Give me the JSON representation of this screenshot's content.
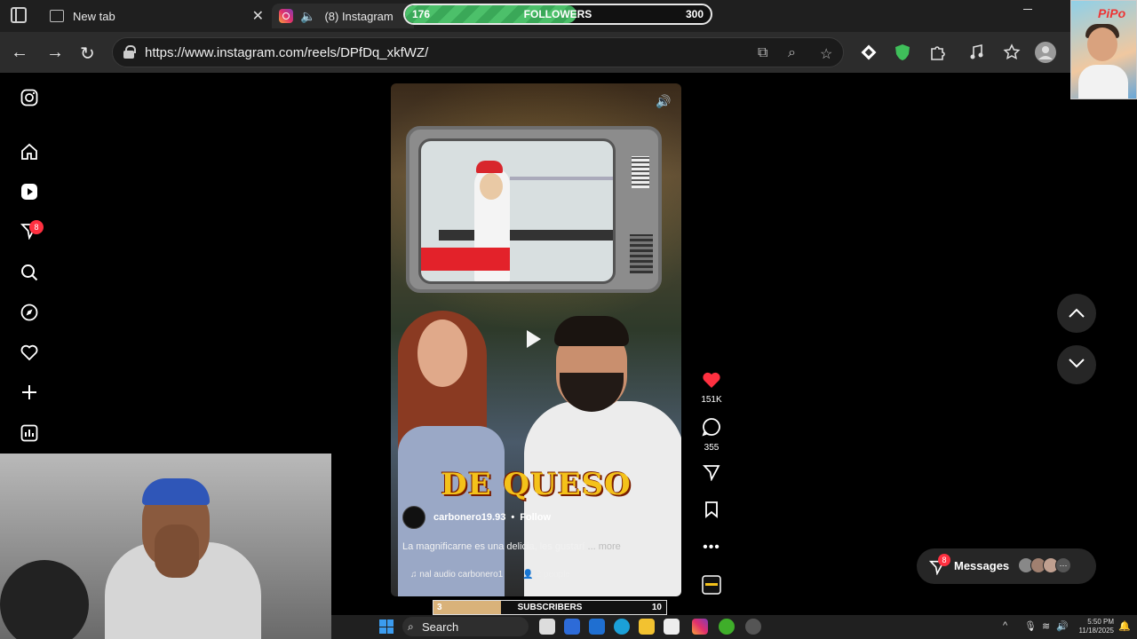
{
  "browser": {
    "tabs": [
      {
        "label": "New tab"
      },
      {
        "label": "(8) Instagram"
      }
    ],
    "url": "https://www.instagram.com/reels/DPfDq_xkfWZ/"
  },
  "overlay": {
    "followers": {
      "start": "176",
      "label": "FOLLOWERS",
      "end": "300",
      "progress": 0.56
    },
    "subscribers": {
      "start": "3",
      "label": "SUBSCRIBERS",
      "end": "10",
      "progress": 0.29
    },
    "avatar_tag": "PiPo"
  },
  "sidebar": {
    "items": [
      "instagram-logo",
      "home",
      "reels",
      "messages",
      "search",
      "explore",
      "notifications",
      "create",
      "dashboard"
    ],
    "messages_badge": "8"
  },
  "reel": {
    "caption_big": "DE QUESO",
    "author": "carbonero19.93",
    "follow": "Follow",
    "description": "La magnificarne es una delicia, les gustarí",
    "more": "... more",
    "audio": "nal audio carbonero1",
    "people": "2 people",
    "likes": "151K",
    "comments": "355"
  },
  "messages": {
    "label": "Messages",
    "badge": "8"
  },
  "taskbar": {
    "search": "Search",
    "time": "5:50 PM",
    "date": "11/18/2025"
  },
  "colors": {
    "like_red": "#ff3040",
    "followers_green": "#4cc06a",
    "caption_yellow": "#f4c21a"
  }
}
